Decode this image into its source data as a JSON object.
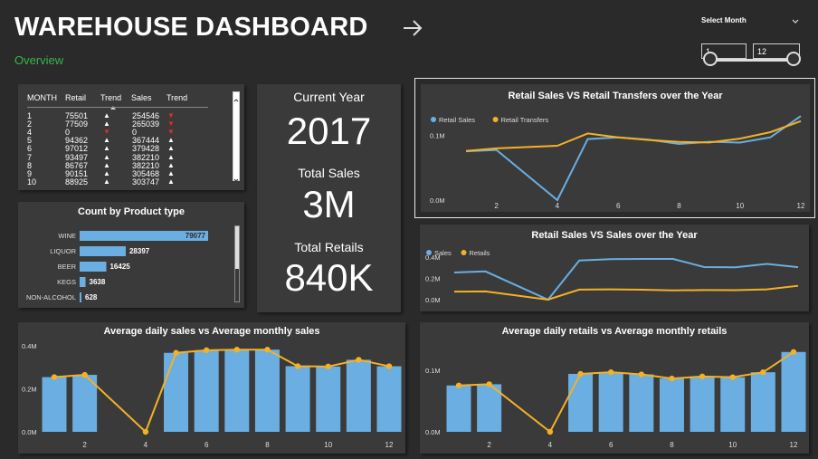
{
  "header": {
    "title": "WAREHOUSE DASHBOARD",
    "subtitle": "Overview"
  },
  "slicer": {
    "label": "Select Month",
    "from": "1",
    "to": "12",
    "range": [
      1,
      12
    ]
  },
  "table": {
    "columns": [
      "MONTH",
      "Retail",
      "Trend",
      "Sales",
      "Trend"
    ],
    "rows": [
      {
        "month": "1",
        "retail": "75501",
        "retail_trend": "▲",
        "sales": "254546",
        "sales_trend": "▼",
        "sales_trend_dir": "down"
      },
      {
        "month": "2",
        "retail": "77509",
        "retail_trend": "▲",
        "sales": "265039",
        "sales_trend": "▼",
        "sales_trend_dir": "down"
      },
      {
        "month": "4",
        "retail": "0",
        "retail_trend": "▼",
        "retail_trend_dir": "down",
        "sales": "0",
        "sales_trend": "▼",
        "sales_trend_dir": "down"
      },
      {
        "month": "5",
        "retail": "94362",
        "retail_trend": "▲",
        "sales": "367444",
        "sales_trend": "▲"
      },
      {
        "month": "6",
        "retail": "97012",
        "retail_trend": "▲",
        "sales": "379428",
        "sales_trend": "▲"
      },
      {
        "month": "7",
        "retail": "93497",
        "retail_trend": "▲",
        "sales": "382210",
        "sales_trend": "▲"
      },
      {
        "month": "8",
        "retail": "86767",
        "retail_trend": "▲",
        "sales": "382210",
        "sales_trend": "▲"
      },
      {
        "month": "9",
        "retail": "90151",
        "retail_trend": "▲",
        "sales": "305468",
        "sales_trend": "▲"
      },
      {
        "month": "10",
        "retail": "88925",
        "retail_trend": "▲",
        "sales": "303747",
        "sales_trend": "▲"
      }
    ]
  },
  "kpi": {
    "current_year_label": "Current Year",
    "current_year": "2017",
    "total_sales_label": "Total Sales",
    "total_sales": "3M",
    "total_retails_label": "Total Retails",
    "total_retails": "840K"
  },
  "colors": {
    "blue": "#6aaee2",
    "orange": "#f4b125",
    "red": "#e02b2b",
    "green": "#3ab54a"
  },
  "chart_data": [
    {
      "type": "bar",
      "title": "Count by Product type",
      "categories": [
        "WINE",
        "LIQUOR",
        "BEER",
        "KEGS",
        "NON-ALCOHOL"
      ],
      "values": [
        79077,
        28397,
        16425,
        3638,
        628
      ],
      "labels": [
        "79077",
        "28397",
        "16425",
        "3638",
        "628"
      ]
    },
    {
      "type": "line",
      "title": "Retail Sales VS Retail Transfers over the Year",
      "legend": [
        "Retail Sales",
        "Retail Transfers"
      ],
      "x": [
        1,
        2,
        4,
        5,
        6,
        7,
        8,
        9,
        10,
        11,
        12
      ],
      "series": [
        {
          "name": "Retail Sales",
          "values": [
            75501,
            77509,
            0,
            94362,
            97012,
            93497,
            86767,
            90151,
            88925,
            97000,
            130000
          ]
        },
        {
          "name": "Retail Transfers",
          "values": [
            76000,
            80000,
            84000,
            103000,
            97000,
            93000,
            90000,
            89000,
            95000,
            105000,
            122000
          ]
        }
      ],
      "ylim": [
        0,
        140000
      ],
      "yticks": [
        "0.0M",
        "0.1M"
      ],
      "xticks": [
        "2",
        "4",
        "6",
        "8",
        "10",
        "12"
      ]
    },
    {
      "type": "line",
      "title": "Retail Sales VS Sales over the Year",
      "legend": [
        "Sales",
        "Retails"
      ],
      "x": [
        1,
        2,
        4,
        5,
        6,
        7,
        8,
        9,
        10,
        11,
        12
      ],
      "series": [
        {
          "name": "Sales",
          "values": [
            254546,
            265039,
            0,
            367444,
            379428,
            382210,
            382210,
            305468,
            303747,
            335000,
            305000
          ]
        },
        {
          "name": "Retails",
          "values": [
            75501,
            77509,
            0,
            94362,
            97012,
            93497,
            86767,
            90151,
            88925,
            97000,
            130000
          ]
        }
      ],
      "ylim": [
        0,
        450000
      ],
      "yticks": [
        "0.0M",
        "0.2M",
        "0.4M"
      ]
    },
    {
      "type": "bar",
      "title": "Average daily sales vs Average monthly sales",
      "x": [
        1,
        2,
        4,
        5,
        6,
        7,
        8,
        9,
        10,
        11,
        12
      ],
      "series": [
        {
          "name": "monthly",
          "values": [
            254546,
            265039,
            0,
            367444,
            379428,
            382210,
            382210,
            305468,
            303747,
            335000,
            305000
          ]
        },
        {
          "name": "daily",
          "values": [
            254546,
            265039,
            0,
            367444,
            379428,
            382210,
            382210,
            305468,
            303747,
            335000,
            305000
          ]
        }
      ],
      "ylim": [
        0,
        400000
      ],
      "yticks": [
        "0.0M",
        "0.2M",
        "0.4M"
      ],
      "xticks": [
        "2",
        "4",
        "6",
        "8",
        "10",
        "12"
      ]
    },
    {
      "type": "bar",
      "title": "Average daily retails vs Average monthly retails",
      "x": [
        1,
        2,
        4,
        5,
        6,
        7,
        8,
        9,
        10,
        11,
        12
      ],
      "series": [
        {
          "name": "monthly",
          "values": [
            75501,
            77509,
            0,
            94362,
            97012,
            93497,
            86767,
            90151,
            88925,
            97000,
            130000
          ]
        },
        {
          "name": "daily",
          "values": [
            75501,
            77509,
            0,
            94362,
            97012,
            93497,
            86767,
            90151,
            88925,
            97000,
            130000
          ]
        }
      ],
      "ylim": [
        0,
        140000
      ],
      "yticks": [
        "0.0M",
        "0.1M"
      ],
      "xticks": [
        "2",
        "4",
        "6",
        "8",
        "10",
        "12"
      ]
    }
  ]
}
